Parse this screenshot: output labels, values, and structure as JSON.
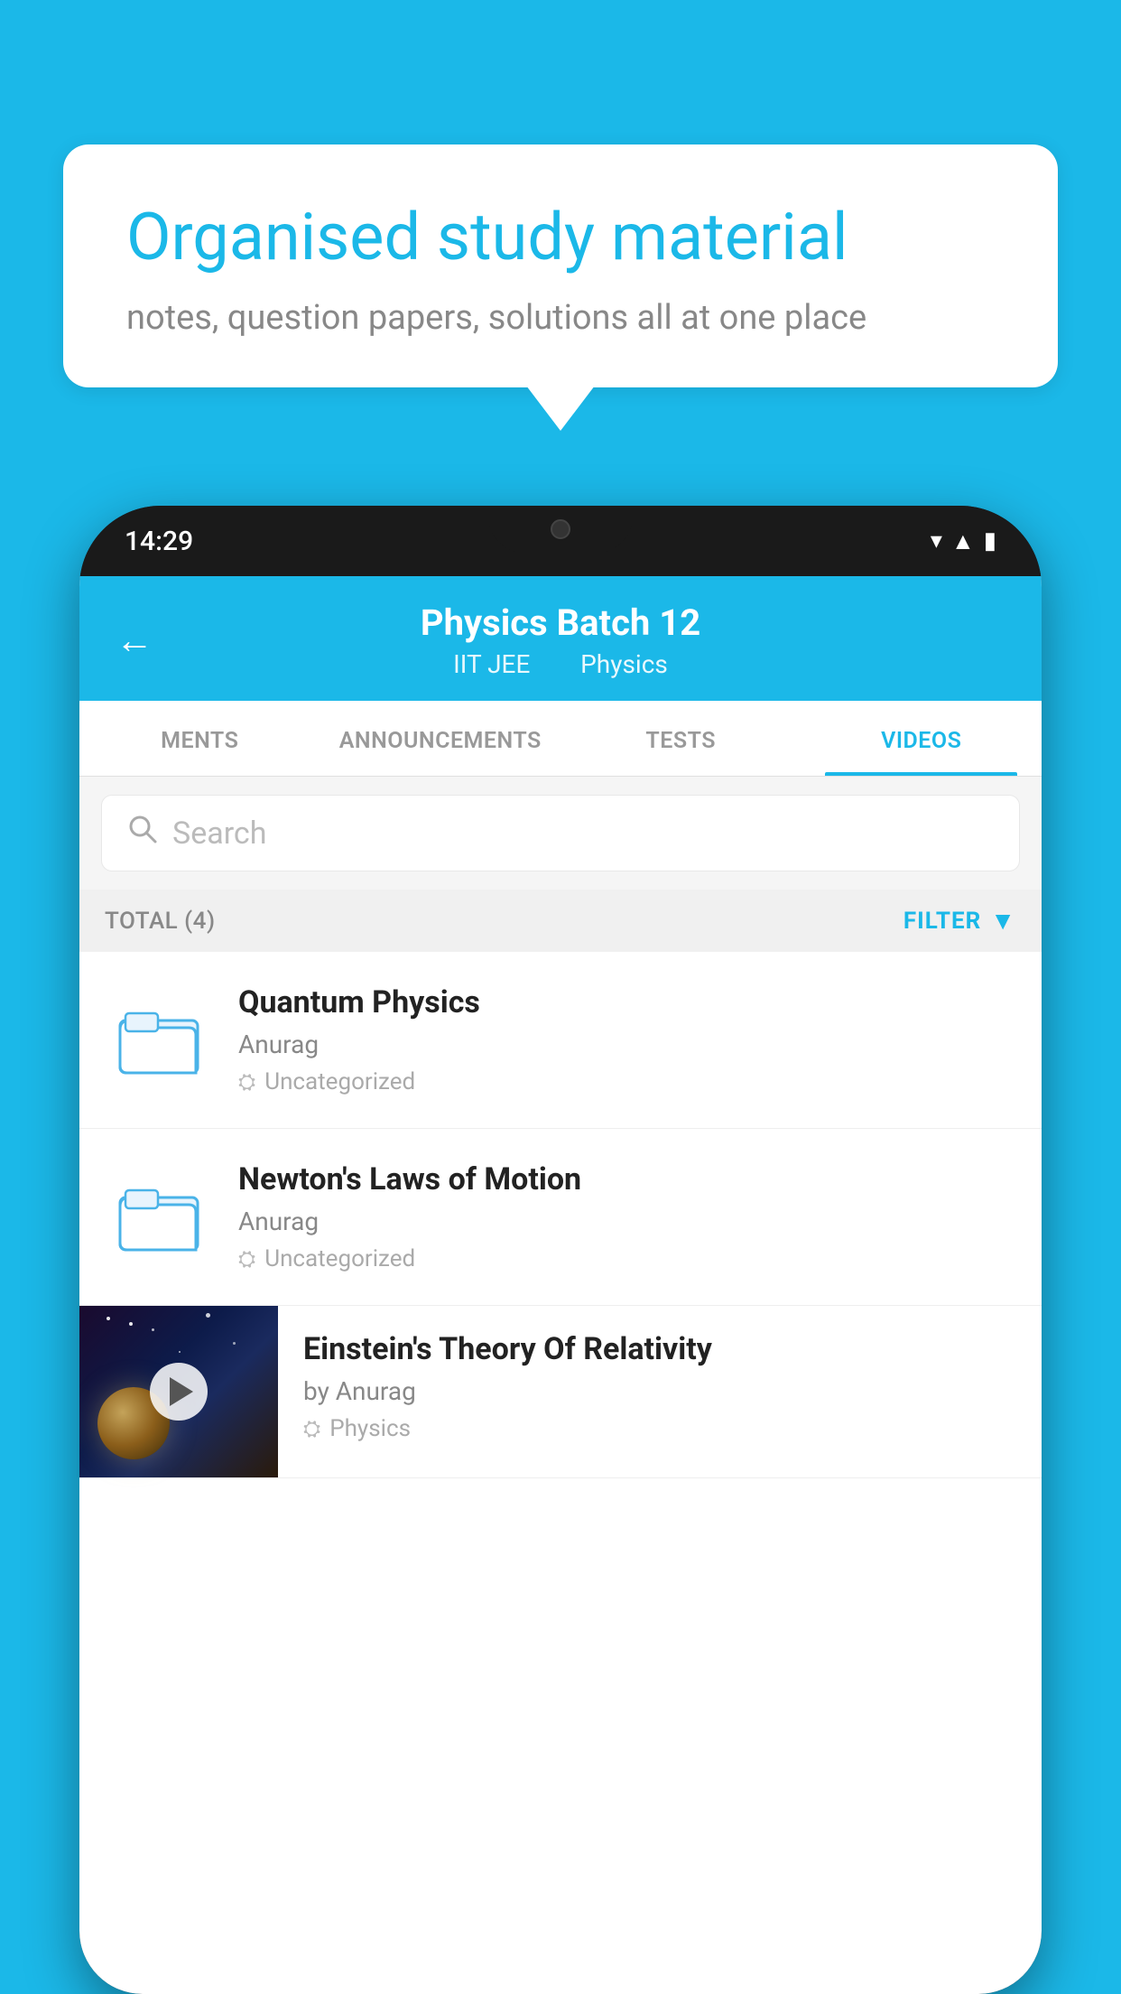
{
  "background": {
    "color": "#1BB8E8"
  },
  "bubble": {
    "title": "Organised study material",
    "subtitle": "notes, question papers, solutions all at one place"
  },
  "phone": {
    "time": "14:29",
    "header": {
      "title": "Physics Batch 12",
      "subtitle_left": "IIT JEE",
      "subtitle_right": "Physics"
    },
    "tabs": [
      {
        "label": "MENTS",
        "active": false
      },
      {
        "label": "ANNOUNCEMENTS",
        "active": false
      },
      {
        "label": "TESTS",
        "active": false
      },
      {
        "label": "VIDEOS",
        "active": true
      }
    ],
    "search": {
      "placeholder": "Search"
    },
    "filter": {
      "total_label": "TOTAL (4)",
      "filter_label": "FILTER"
    },
    "videos": [
      {
        "id": 1,
        "title": "Quantum Physics",
        "author": "Anurag",
        "tag": "Uncategorized",
        "type": "folder"
      },
      {
        "id": 2,
        "title": "Newton's Laws of Motion",
        "author": "Anurag",
        "tag": "Uncategorized",
        "type": "folder"
      },
      {
        "id": 3,
        "title": "Einstein's Theory Of Relativity",
        "author": "by Anurag",
        "tag": "Physics",
        "type": "video"
      }
    ]
  }
}
